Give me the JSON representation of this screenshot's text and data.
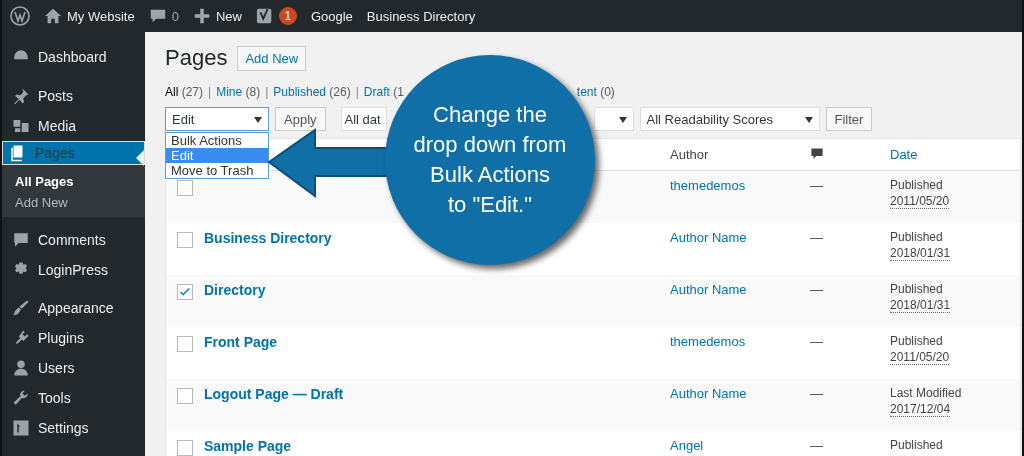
{
  "admin_bar": {
    "site": "My Website",
    "comments": "0",
    "new": "New",
    "notifications": "1",
    "links": [
      "Google",
      "Business Directory"
    ]
  },
  "sidebar": {
    "items": [
      {
        "label": "Dashboard",
        "selected": false
      },
      {
        "label": "Posts",
        "selected": false
      },
      {
        "label": "Media",
        "selected": false
      },
      {
        "label": "Pages",
        "selected": true,
        "children": [
          {
            "label": "All Pages",
            "selected": true
          },
          {
            "label": "Add New",
            "selected": false
          }
        ]
      },
      {
        "label": "Comments",
        "selected": false
      },
      {
        "label": "LoginPress",
        "selected": false
      },
      {
        "label": "Appearance",
        "selected": false
      },
      {
        "label": "Plugins",
        "selected": false
      },
      {
        "label": "Users",
        "selected": false
      },
      {
        "label": "Tools",
        "selected": false
      },
      {
        "label": "Settings",
        "selected": false
      }
    ]
  },
  "page": {
    "title": "Pages",
    "add_new": "Add New",
    "separator": "|",
    "views": [
      {
        "label": "All",
        "count": "(27)",
        "selected": true
      },
      {
        "label": "Mine",
        "count": "(8)",
        "selected": false
      },
      {
        "label": "Published",
        "count": "(26)",
        "selected": false
      },
      {
        "label": "Draft",
        "count": "(1",
        "selected": false
      }
    ],
    "views_tail": {
      "label": "tent",
      "count": "(0)"
    },
    "bulk_action": {
      "value": "Edit",
      "options": [
        {
          "label": "Bulk Actions",
          "selected": false
        },
        {
          "label": "Edit",
          "selected": true
        },
        {
          "label": "Move to Trash",
          "selected": false
        }
      ]
    },
    "apply": "Apply",
    "date_filter": "All dat",
    "readability_filter": "All Readability Scores",
    "filter": "Filter",
    "table": {
      "columns": [
        "Author",
        "Date"
      ],
      "rows": [
        {
          "checked": false,
          "author": "themedemos",
          "comments": "—",
          "status": "Published",
          "date": "2011/05/20"
        },
        {
          "checked": false,
          "title": "Business Directory",
          "author": "Author Name",
          "comments": "—",
          "status": "Published",
          "date": "2018/01/31"
        },
        {
          "checked": true,
          "title": "Directory",
          "author": "Author Name",
          "comments": "—",
          "status": "Published",
          "date": "2018/01/31"
        },
        {
          "checked": false,
          "title": "Front Page",
          "author": "themedemos",
          "comments": "—",
          "status": "Published",
          "date": "2011/05/20"
        },
        {
          "checked": false,
          "title": "Logout Page — Draft",
          "author": "Author Name",
          "comments": "—",
          "status": "Last Modified",
          "date": "2017/12/04"
        },
        {
          "checked": false,
          "title": "Sample Page",
          "author": "Angel",
          "comments": "—",
          "status": "Published"
        }
      ]
    }
  },
  "callout": {
    "lines": [
      "Change the",
      "drop down from",
      "Bulk Actions",
      "to \"Edit.\""
    ]
  }
}
